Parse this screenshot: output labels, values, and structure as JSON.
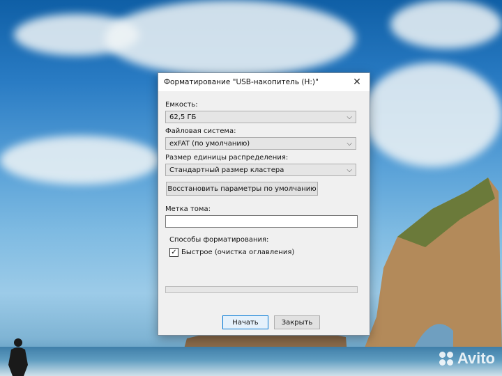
{
  "dialog": {
    "title": "Форматирование \"USB-накопитель (H:)\"",
    "capacity_label": "Емкость:",
    "capacity_value": "62,5 ГБ",
    "filesystem_label": "Файловая система:",
    "filesystem_value": "exFAT (по умолчанию)",
    "cluster_label": "Размер единицы распределения:",
    "cluster_value": "Стандартный размер кластера",
    "restore_button": "Восстановить параметры по умолчанию",
    "volume_label": "Метка тома:",
    "volume_value": "",
    "format_options_label": "Способы форматирования:",
    "quick_format_label": "Быстрое (очистка оглавления)",
    "quick_format_checked": true,
    "progress": 0,
    "start_button": "Начать",
    "close_button": "Закрыть"
  },
  "icons": {
    "close": "close-icon",
    "dropdown": "chevron-down-icon",
    "check": "checkmark-icon"
  },
  "watermark": {
    "text": "Avito"
  }
}
